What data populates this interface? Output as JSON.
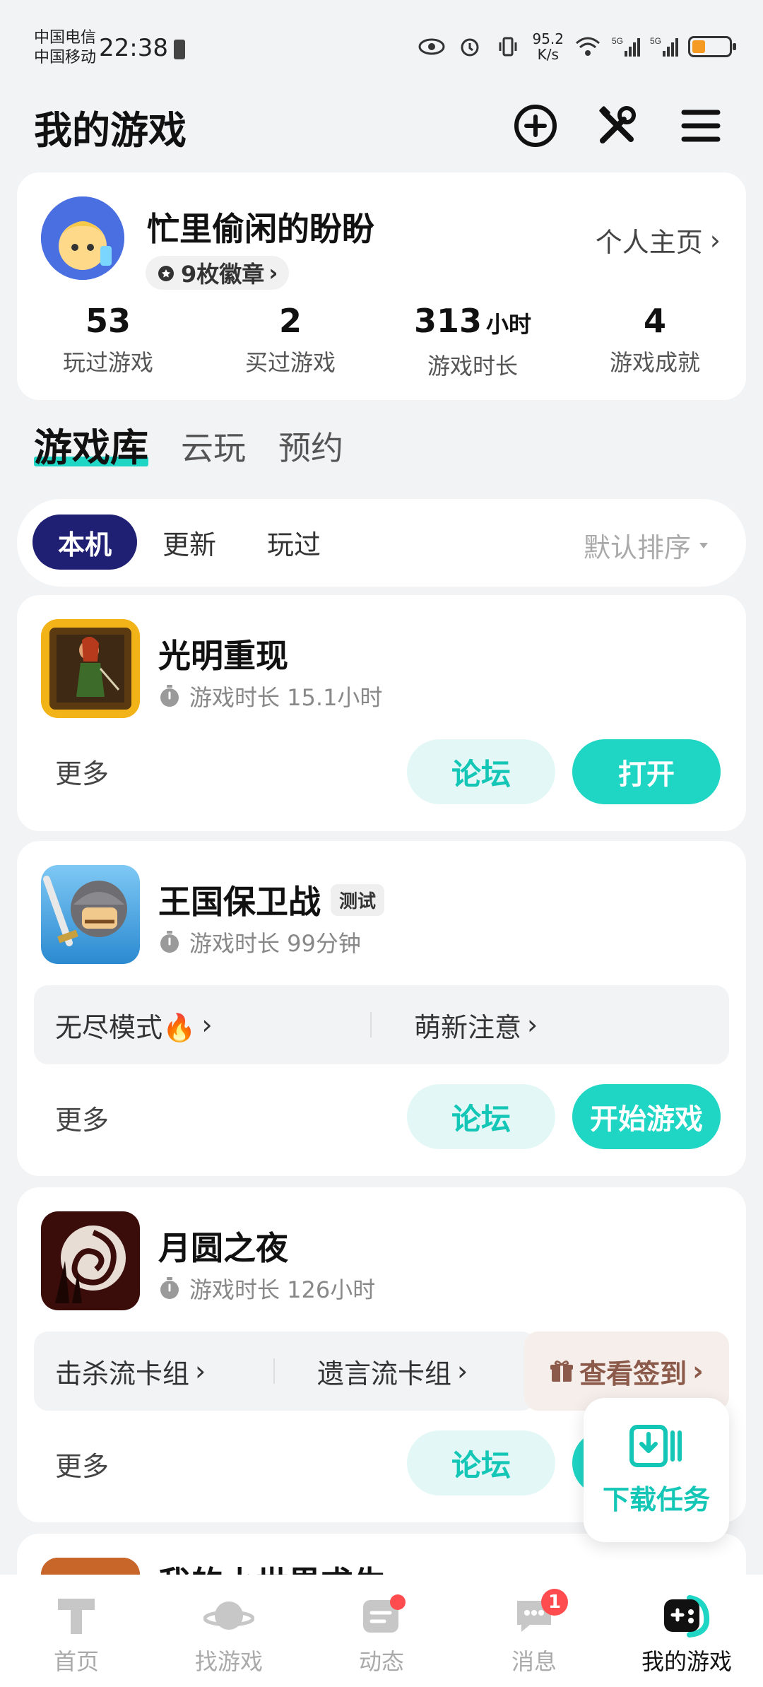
{
  "status_bar": {
    "carrier_1": "中国电信",
    "carrier_2": "中国移动",
    "time": "22:38",
    "net_speed_value": "95.2",
    "net_speed_unit": "K/s",
    "signal_1": "5G",
    "signal_2": "5G",
    "battery_color": "#f59a23"
  },
  "header": {
    "title": "我的游戏",
    "icons": [
      "add-circle-icon",
      "tools-icon",
      "menu-icon"
    ]
  },
  "profile": {
    "username": "忙里偷闲的盼盼",
    "badges": "9枚徽章",
    "home_link": "个人主页",
    "stats": [
      {
        "value": "53",
        "unit": "",
        "label": "玩过游戏"
      },
      {
        "value": "2",
        "unit": "",
        "label": "买过游戏"
      },
      {
        "value": "313",
        "unit": "小时",
        "label": "游戏时长"
      },
      {
        "value": "4",
        "unit": "",
        "label": "游戏成就"
      }
    ]
  },
  "main_tabs": [
    "游戏库",
    "云玩",
    "预约"
  ],
  "filter": {
    "tabs": [
      "本机",
      "更新",
      "玩过"
    ],
    "sort": "默认排序"
  },
  "games": [
    {
      "title": "光明重现",
      "tag": "",
      "playtime": "游戏时长 15.1小时",
      "more": "更多",
      "forum": "论坛",
      "action": "打开"
    },
    {
      "title": "王国保卫战",
      "tag": "测试",
      "playtime": "游戏时长 99分钟",
      "links": [
        "无尽模式🔥",
        "萌新注意"
      ],
      "more": "更多",
      "forum": "论坛",
      "action": "开始游戏"
    },
    {
      "title": "月圆之夜",
      "tag": "",
      "playtime": "游戏时长 126小时",
      "links": [
        "击杀流卡组",
        "遗言流卡组"
      ],
      "checkin": "查看签到",
      "more": "更多",
      "forum": "论坛",
      "action": ""
    },
    {
      "title": "我的小世界求生"
    }
  ],
  "download": {
    "label": "下载任务"
  },
  "bottom_nav": [
    {
      "label": "首页",
      "badge": ""
    },
    {
      "label": "找游戏",
      "badge": ""
    },
    {
      "label": "动态",
      "badge": "dot"
    },
    {
      "label": "消息",
      "badge": "1"
    },
    {
      "label": "我的游戏",
      "badge": ""
    }
  ],
  "colors": {
    "accent": "#1fd5c4",
    "active_filter": "#1f1f73"
  }
}
